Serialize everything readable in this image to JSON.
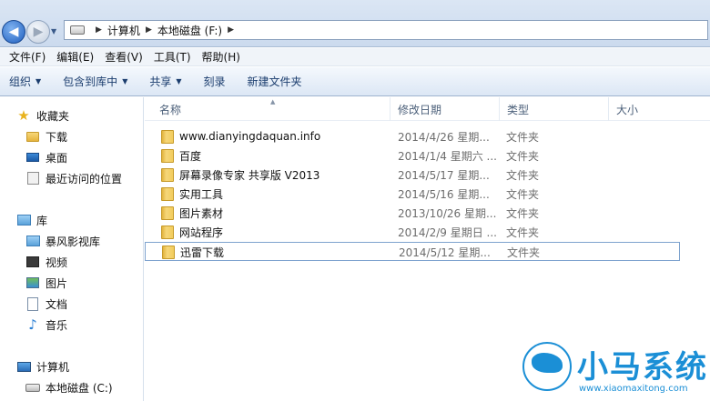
{
  "address": {
    "breadcrumbs": [
      "计算机",
      "本地磁盘 (F:)"
    ]
  },
  "menu": [
    "文件(F)",
    "编辑(E)",
    "查看(V)",
    "工具(T)",
    "帮助(H)"
  ],
  "toolbar": {
    "organize": "组织",
    "include_library": "包含到库中",
    "share": "共享",
    "burn": "刻录",
    "new_folder": "新建文件夹"
  },
  "nav": {
    "favorites": "收藏夹",
    "downloads": "下载",
    "desktop": "桌面",
    "recent": "最近访问的位置",
    "libraries": "库",
    "baofeng": "暴风影视库",
    "videos": "视频",
    "pictures": "图片",
    "documents": "文档",
    "music": "音乐",
    "computer": "计算机",
    "local_disk_c": "本地磁盘 (C:)"
  },
  "columns": {
    "name": "名称",
    "date": "修改日期",
    "type": "类型",
    "size": "大小"
  },
  "files": [
    {
      "name": "www.dianyingdaquan.info",
      "date": "2014/4/26 星期...",
      "type": "文件夹"
    },
    {
      "name": "百度",
      "date": "2014/1/4 星期六 ...",
      "type": "文件夹"
    },
    {
      "name": "屏幕录像专家 共享版 V2013",
      "date": "2014/5/17 星期...",
      "type": "文件夹"
    },
    {
      "name": "实用工具",
      "date": "2014/5/16 星期...",
      "type": "文件夹"
    },
    {
      "name": "图片素材",
      "date": "2013/10/26 星期...",
      "type": "文件夹"
    },
    {
      "name": "网站程序",
      "date": "2014/2/9 星期日 ...",
      "type": "文件夹"
    },
    {
      "name": "迅雷下载",
      "date": "2014/5/12 星期...",
      "type": "文件夹"
    }
  ],
  "watermark": {
    "title": "小马系统",
    "url": "www.xiaomaxitong.com"
  },
  "colors": {
    "accent": "#1b8fd6",
    "toolbar_text": "#1b3d6e"
  }
}
